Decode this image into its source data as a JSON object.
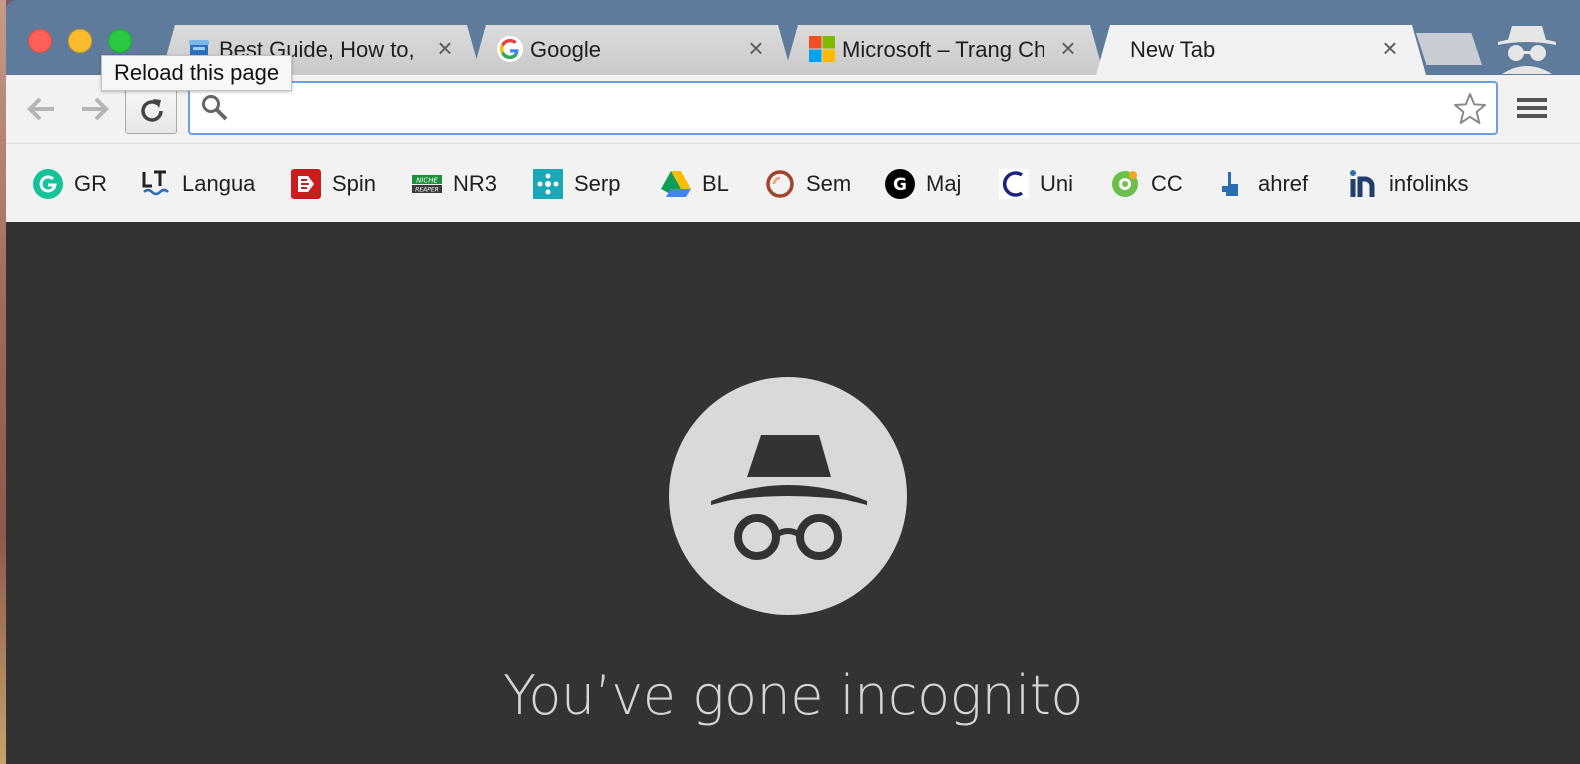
{
  "tabs": [
    {
      "title": "Best Guide, How to,",
      "favicon": "cup-favicon-icon",
      "active": false
    },
    {
      "title": "Google",
      "favicon": "google-favicon-icon",
      "active": false
    },
    {
      "title": "Microsoft – Trang Ch",
      "favicon": "microsoft-favicon-icon",
      "active": false
    },
    {
      "title": "New Tab",
      "favicon": "",
      "active": true
    }
  ],
  "tooltip": {
    "text": "Reload this page"
  },
  "omnibox": {
    "value": "",
    "placeholder": ""
  },
  "bookmarks": [
    {
      "label": "GR",
      "icon": "grammarly-icon"
    },
    {
      "label": "Langua",
      "icon": "languagetool-icon"
    },
    {
      "label": "Spin",
      "icon": "spin-icon"
    },
    {
      "label": "NR3",
      "icon": "niche-reaper-icon"
    },
    {
      "label": "Serp",
      "icon": "serp-icon"
    },
    {
      "label": "BL",
      "icon": "google-drive-icon"
    },
    {
      "label": "Sem",
      "icon": "semrush-icon"
    },
    {
      "label": "Maj",
      "icon": "majestic-icon"
    },
    {
      "label": "Uni",
      "icon": "uni-icon"
    },
    {
      "label": "CC",
      "icon": "cc-icon"
    },
    {
      "label": "ahref",
      "icon": "ahrefs-icon"
    },
    {
      "label": "infolinks",
      "icon": "infolinks-icon"
    }
  ],
  "content": {
    "headline": "You’ve gone incognito"
  },
  "colors": {
    "tab_strip": "#5f7b9c",
    "toolbar": "#f2f2f2",
    "content_bg": "#333333",
    "focus_ring": "#6a9ee8"
  }
}
